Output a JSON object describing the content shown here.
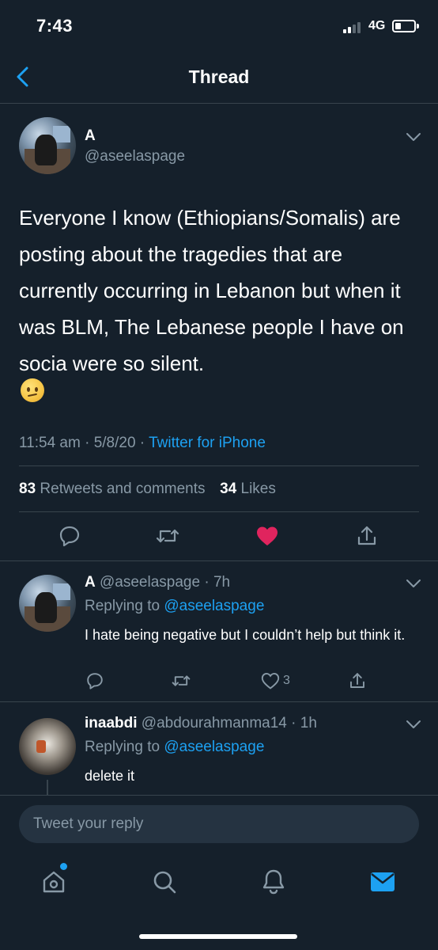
{
  "status_bar": {
    "time": "7:43",
    "network": "4G",
    "battery_level": 0.3
  },
  "header": {
    "title": "Thread"
  },
  "main_tweet": {
    "display_name": "A",
    "handle": "@aseelaspage",
    "text": "Everyone I know (Ethiopians/Somalis) are posting about the tragedies that are currently occurring in Lebanon but when it was BLM, The Lebanese people I have on socia were so silent.",
    "emoji": "confused-face",
    "time": "11:54 am",
    "dot1": " · ",
    "date": "5/8/20",
    "dot2": " · ",
    "source": "Twitter for iPhone",
    "retweets_count": "83",
    "retweets_label": "Retweets and comments",
    "likes_count": "34",
    "likes_label": "Likes",
    "liked": true,
    "like_color": "#e0245e"
  },
  "replies": [
    {
      "display_name": "A",
      "handle": "@aseelaspage",
      "age": "· 7h",
      "replying_label": "Replying to",
      "replying_to": "@aseelaspage",
      "text": "I hate being negative but I couldn’t help but think it.",
      "like_count": "3"
    },
    {
      "display_name": "inaabdi",
      "handle": "@abdourahmanma14",
      "age": "· 1h",
      "replying_label": "Replying to",
      "replying_to": "@aseelaspage",
      "text": "delete it"
    }
  ],
  "composer": {
    "placeholder": "Tweet your reply"
  },
  "tabs": [
    "home-icon",
    "search-icon",
    "notifications-icon",
    "messages-icon"
  ],
  "colors": {
    "background": "#15202b",
    "accent": "#1da1f2",
    "muted": "#8899a6",
    "divider": "#38444d"
  }
}
